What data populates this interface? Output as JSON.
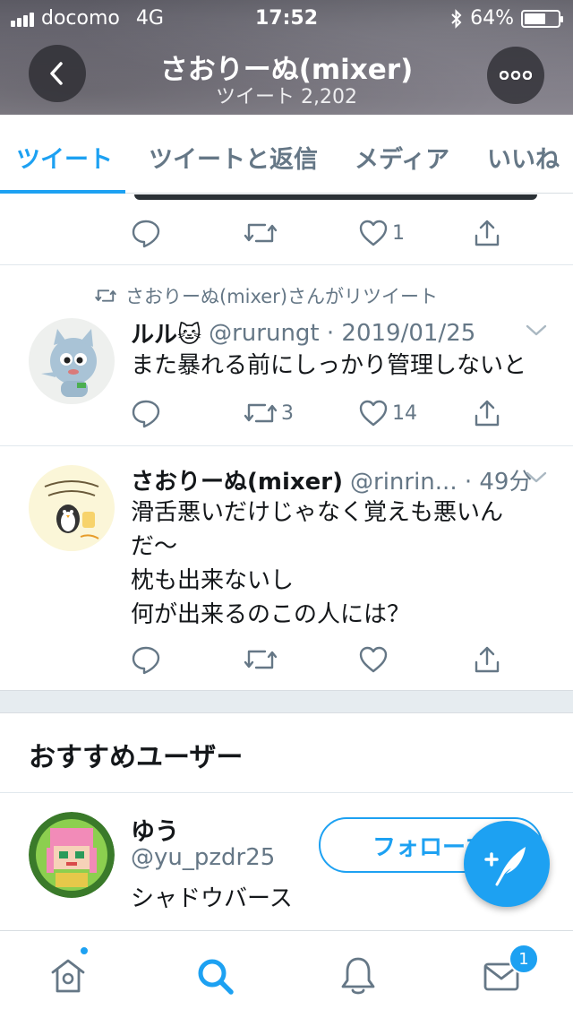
{
  "status_bar": {
    "carrier": "docomo",
    "network": "4G",
    "time": "17:52",
    "battery": "64%",
    "battery_level": 0.64
  },
  "header": {
    "title": "さおりーぬ(mixer)",
    "subtitle": "ツイート 2,202"
  },
  "tabs": [
    {
      "label": "ツイート",
      "active": true
    },
    {
      "label": "ツイートと返信",
      "active": false
    },
    {
      "label": "メディア",
      "active": false
    },
    {
      "label": "いいね",
      "active": false
    }
  ],
  "tweets": [
    {
      "reply_count": "",
      "retweet_count": "",
      "like_count": "1"
    },
    {
      "retweet_context": "さおりーぬ(mixer)さんがリツイート",
      "name": "ルル🐱",
      "handle_time": "@rurungt · 2019/01/25",
      "text": "また暴れる前にしっかり管理しないと",
      "retweet_count": "3",
      "like_count": "14"
    },
    {
      "name": "さおりーぬ(mixer)",
      "handle_time": "@rinrin... · 49分",
      "text_lines": [
        "滑舌悪いだけじゃなく覚えも悪いん",
        "だ〜",
        "枕も出来ないし",
        "何が出来るのこの人には？"
      ],
      "retweet_count": "",
      "like_count": ""
    }
  ],
  "recommended": {
    "title": "おすすめユーザー",
    "user": {
      "name": "ゆう",
      "handle": "@yu_pzdr25",
      "bio": "シャドウバース",
      "follow_label": "フォローす"
    }
  },
  "bottom_nav": {
    "messages_badge": "1",
    "home_has_dot": true
  },
  "colors": {
    "accent": "#1da1f2",
    "secondary_text": "#657786",
    "divider": "#e1e8ed"
  }
}
